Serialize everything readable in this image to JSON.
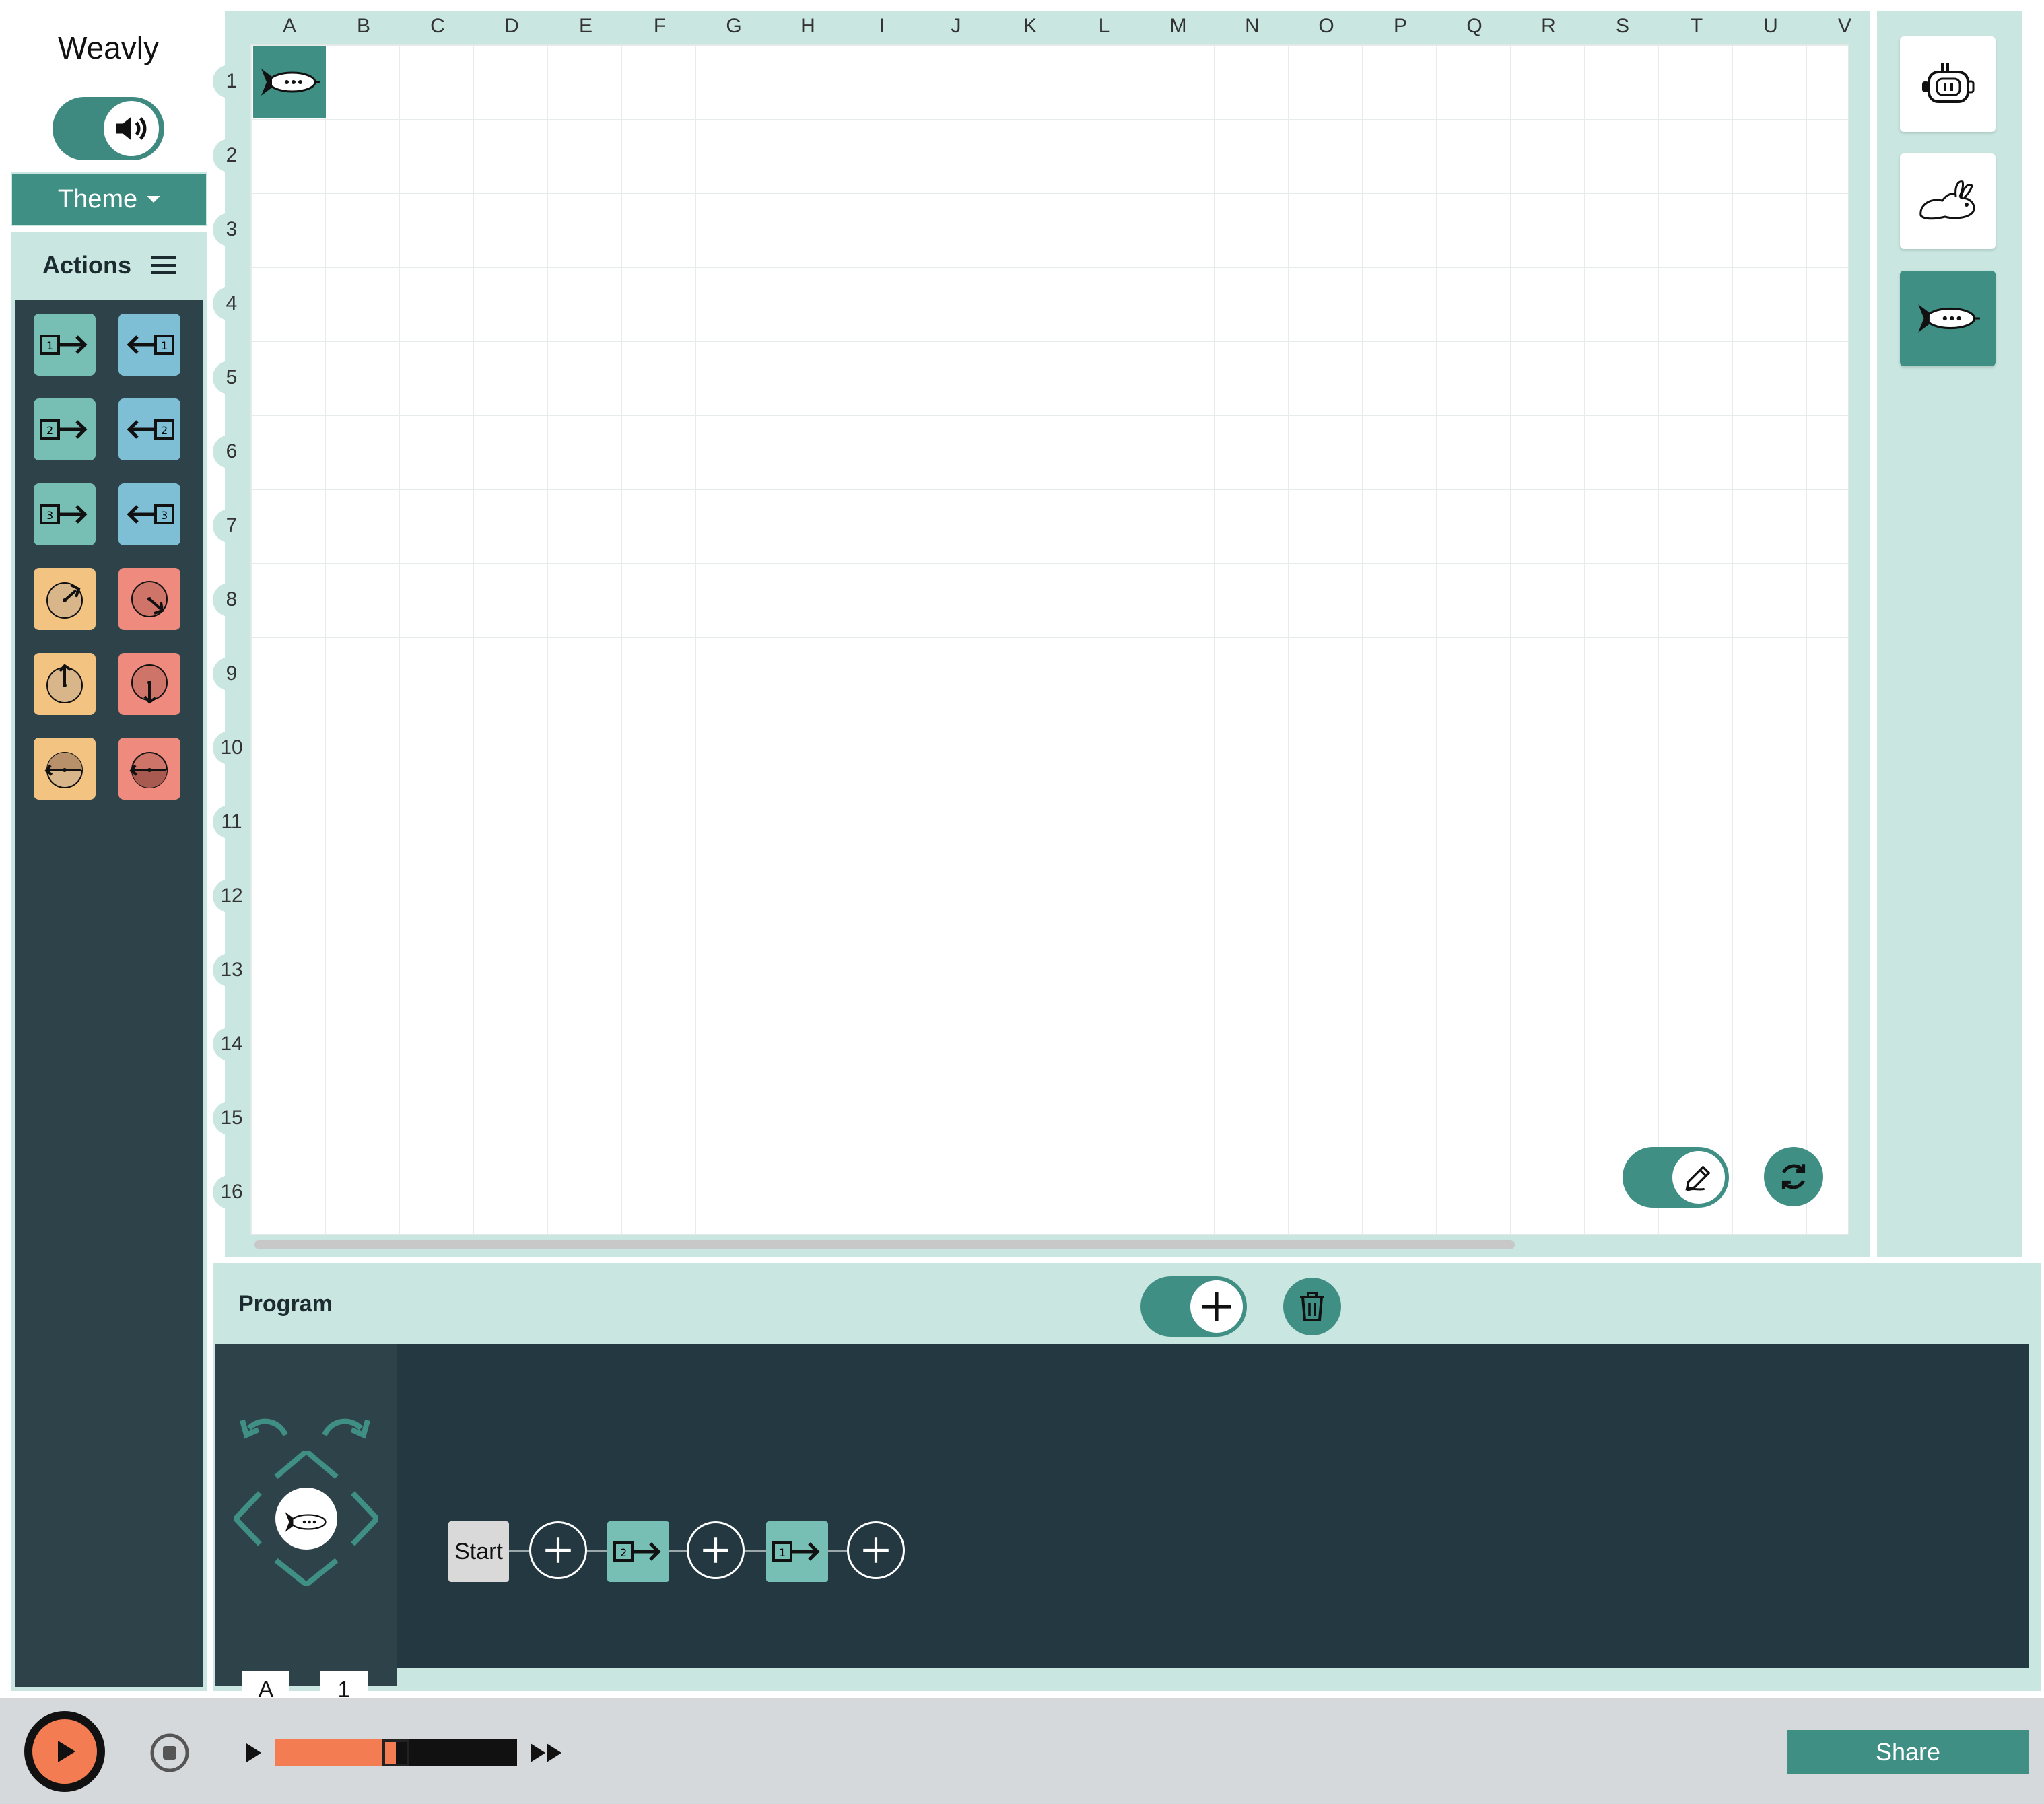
{
  "app": {
    "title": "Weavly"
  },
  "theme_button": {
    "label": "Theme"
  },
  "actions": {
    "header": "Actions"
  },
  "grid": {
    "columns": [
      "A",
      "B",
      "C",
      "D",
      "E",
      "F",
      "G",
      "H",
      "I",
      "J",
      "K",
      "L",
      "M",
      "N",
      "O",
      "P",
      "Q",
      "R",
      "S",
      "T",
      "U",
      "V"
    ],
    "rows": [
      "1",
      "2",
      "3",
      "4",
      "5",
      "6",
      "7",
      "8",
      "9",
      "10",
      "11",
      "12",
      "13",
      "14",
      "15",
      "16"
    ],
    "robot_position": "A1"
  },
  "program": {
    "title": "Program",
    "start_label": "Start",
    "position_column": "A",
    "position_row": "1",
    "steps": [
      {
        "icon": "move-forward-2-icon",
        "number": "2"
      },
      {
        "icon": "move-forward-1-icon",
        "number": "1"
      }
    ]
  },
  "playback": {
    "speed_level": 0.5
  },
  "share": {
    "label": "Share"
  },
  "colors": {
    "accent": "#3f8f85",
    "panel": "#c9e6e0",
    "dark": "#2e4249",
    "move_forward": "#77bfb4",
    "move_backward": "#7fbfd6",
    "turn_left": "#f3c382",
    "turn_right": "#ee8a7e",
    "play": "#f47c52"
  }
}
